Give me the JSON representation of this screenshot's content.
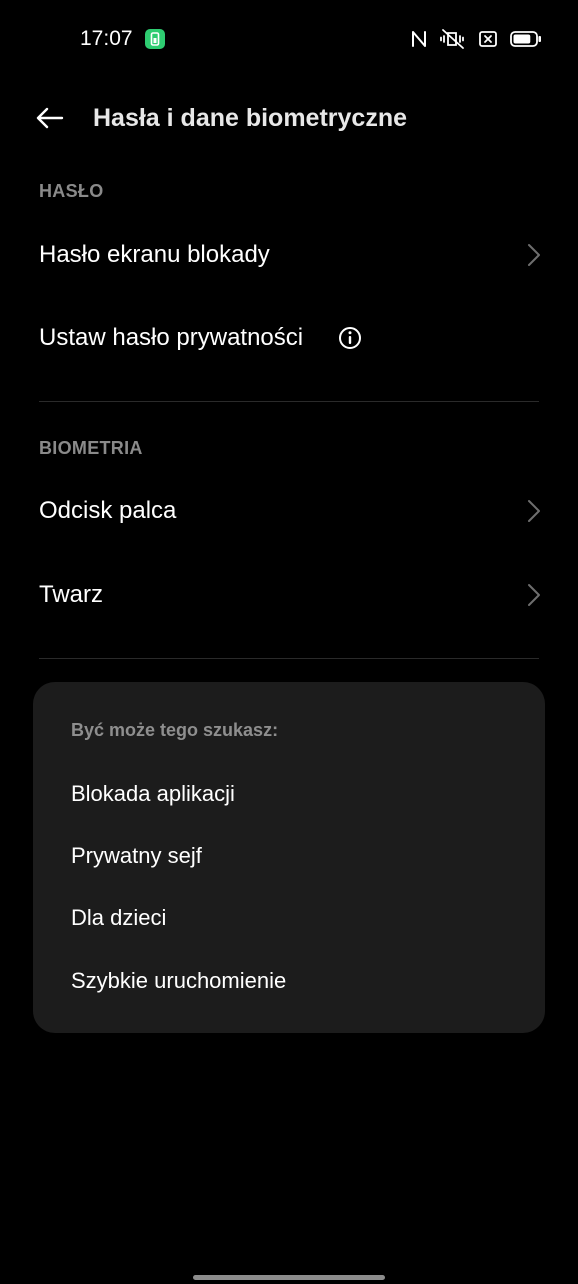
{
  "status_bar": {
    "time": "17:07",
    "icons": [
      "nfc-icon",
      "vibrate-off-icon",
      "sim-off-icon",
      "battery-icon"
    ],
    "badge_color": "#2ecc71",
    "battery_level": 0.8
  },
  "toolbar": {
    "title": "Hasła i dane biometryczne",
    "back_icon": "arrow-left-icon"
  },
  "sections": {
    "password": {
      "header": "HASŁO",
      "items": [
        {
          "label": "Hasło ekranu blokady"
        },
        {
          "label": "Ustaw hasło prywatności"
        }
      ]
    },
    "biometrics": {
      "header": "BIOMETRIA",
      "items": [
        {
          "label": "Odcisk palca"
        },
        {
          "label": "Twarz"
        }
      ]
    }
  },
  "suggestions": {
    "title": "Być może tego szukasz:",
    "items": [
      {
        "label": "Blokada aplikacji"
      },
      {
        "label": "Prywatny sejf"
      },
      {
        "label": "Dla dzieci"
      },
      {
        "label": "Szybkie uruchomienie"
      }
    ]
  },
  "colors": {
    "background": "#000000",
    "card": "#1c1c1c",
    "section_header": "#8a8a8a",
    "text": "#ffffff",
    "accent_badge": "#2ecc71"
  }
}
